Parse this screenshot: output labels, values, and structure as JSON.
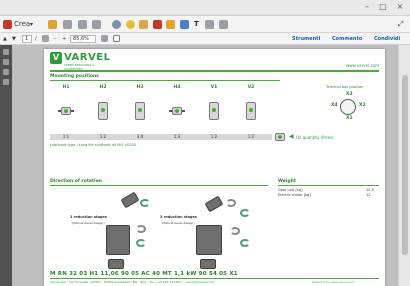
{
  "app": {
    "toolbar": {
      "create_label": "Crea",
      "zoom_value": "85,6%",
      "page_value": "1",
      "right_links": [
        "Strumenti",
        "Commento",
        "Condividi"
      ]
    }
  },
  "doc": {
    "brand": "VARVEL",
    "brand_tagline": "SPEED REDUCERS & GEARBOXES",
    "url": "www.varvel.com",
    "mounting": {
      "title": "Mounting positions",
      "positions": [
        "H1",
        "H2",
        "H3",
        "H4",
        "V1",
        "V2"
      ],
      "ratios": [
        "1:1",
        "1:2",
        "3:4",
        "1:3",
        "1:2",
        "1:2"
      ],
      "qty_note": "Oil quantity (litres)",
      "lubricant_note": "Lubricant type : Long life synthetic oil ISO VG320",
      "terminal_title": "Terminal box position",
      "terminal_labels": [
        "X3",
        "X4",
        "X2",
        "X1"
      ]
    },
    "rotation": {
      "title": "Direction of rotation",
      "stage2_label": "2 reduction stages",
      "stage2_sub": "(Helical bevel design)",
      "stage3_label": "3 reduction stages",
      "stage3_sub": "(Helical bevel design)"
    },
    "weight": {
      "title": "Weight",
      "rows": [
        {
          "label": "Gear unit [kg]",
          "value": "12,5"
        },
        {
          "label": "Electric motor [kg]",
          "value": "12"
        }
      ]
    },
    "code": "M RN 32 03 H1 11,06 90 05 AC 40 MT 1,1 kW 90 S4 05 X1",
    "footer_left": "Varvel Spa - Via Fiorgnelli, 1045/A - 40069 Crespellano BO - Italy - Tel. +39 051 6721811 - varvel@varvel.com",
    "footer_right": "Powered by www.varvel.com"
  },
  "colors": {
    "brand_green": "#2e9b3c",
    "accent_teal": "#4c9b86"
  }
}
